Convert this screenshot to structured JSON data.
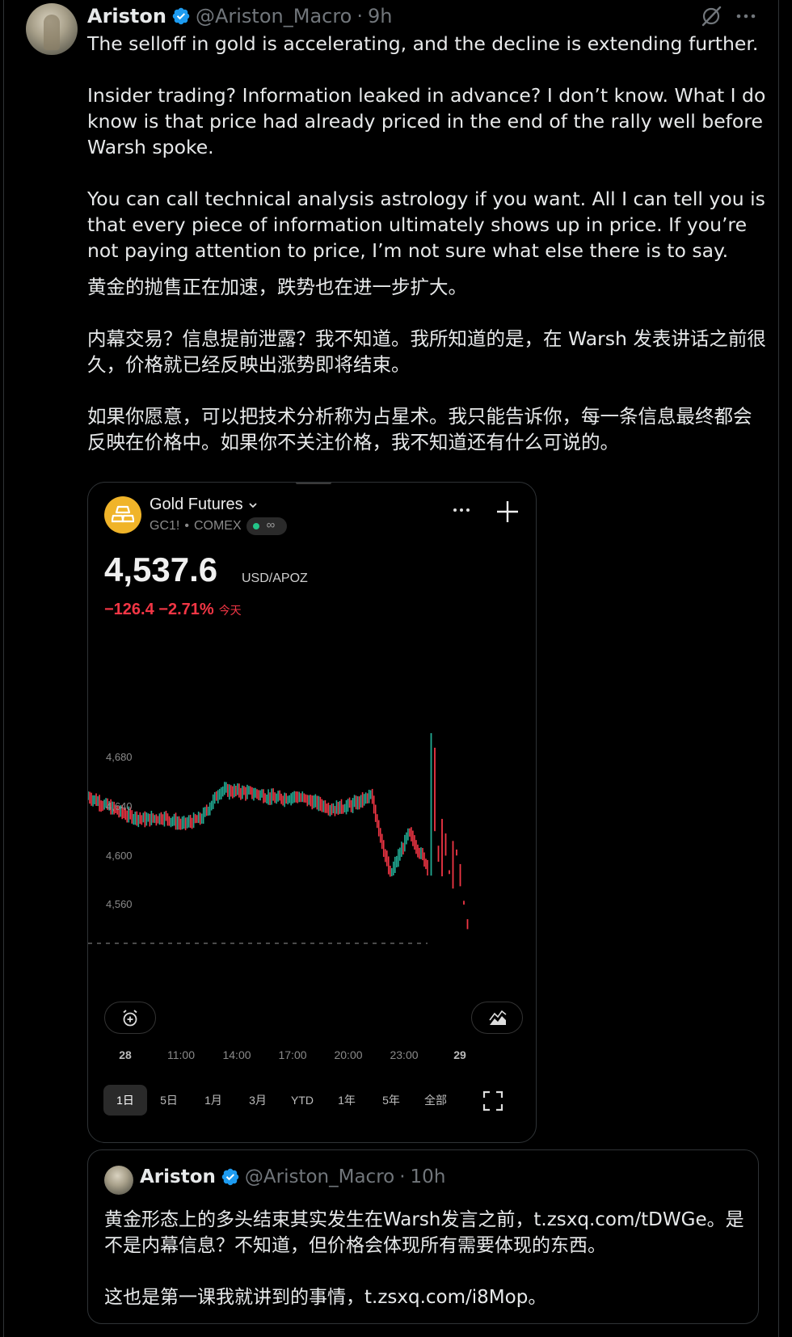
{
  "tweet": {
    "author_name": "Ariston",
    "handle": "@Ariston_Macro",
    "separator": "·",
    "time": "9h",
    "text_en": "The selloff in gold is accelerating, and the decline is extending further.\n\nInsider trading? Information leaked in advance? I don’t know. What I do know is that price had already priced in the end of the rally well before Warsh spoke.\n\nYou can call technical analysis astrology if you want. All I can tell you is that every piece of information ultimately shows up in price. If you’re not paying attention to price, I’m not sure what else there is to say.",
    "text_cn": "黄金的抛售正在加速，跌势也在进一步扩大。\n\n内幕交易？信息提前泄露？我不知道。我所知道的是，在 Warsh 发表讲话之前很久，价格就已经反映出涨势即将结束。\n\n如果你愿意，可以把技术分析称为占星术。我只能告诉你，每一条信息最终都会反映在价格中。如果你不关注价格，我不知道还有什么可说的。",
    "icons": [
      "verified-badge-icon",
      "grok-icon",
      "more-icon"
    ],
    "accent_color": "#1d9bf0"
  },
  "card": {
    "symbol_name": "Gold Futures",
    "ticker": "GC1!",
    "dot": "•",
    "exchange": "COMEX",
    "live_symbol": "∞",
    "price": "4,537.6",
    "unit": "USD/APOZ",
    "change": "−126.4 −2.71%",
    "today_label": "今天",
    "down_color": "#f23645",
    "up_color": "#22ab94",
    "x_labels": [
      "28",
      "11:00",
      "14:00",
      "17:00",
      "20:00",
      "23:00",
      "29"
    ],
    "ranges": [
      "1日",
      "5日",
      "1月",
      "3月",
      "YTD",
      "1年",
      "5年",
      "全部"
    ],
    "active_range": "1日"
  },
  "chart_data": {
    "type": "line",
    "title": "",
    "xlabel": "",
    "ylabel": "",
    "y_ticks": [
      "4,680",
      "4,640",
      "4,600",
      "4,560"
    ],
    "ylim": [
      4535,
      4700
    ],
    "x": [
      "28",
      "",
      "",
      "11:00",
      "",
      "",
      "14:00",
      "",
      "",
      "17:00",
      "",
      "",
      "20:00",
      "",
      "",
      "23:00",
      "",
      "",
      "29"
    ],
    "series": [
      {
        "values": [
          4655,
          4647,
          4640,
          4636,
          4638,
          4632,
          4637,
          4660,
          4659,
          4657,
          4653,
          4655,
          4650,
          4645,
          4648,
          4655,
          4590,
          4625,
          4598
        ]
      }
    ],
    "reference_line": 4535
  },
  "quote": {
    "author_name": "Ariston",
    "handle": "@Ariston_Macro",
    "separator": "·",
    "time": "10h",
    "text": "黄金形态上的多头结束其实发生在Warsh发言之前，t.zsxq.com/tDWGe。是不是内幕信息？不知道，但价格会体现所有需要体现的东西。\n\n这也是第一课我就讲到的事情，t.zsxq.com/i8Mop。"
  }
}
